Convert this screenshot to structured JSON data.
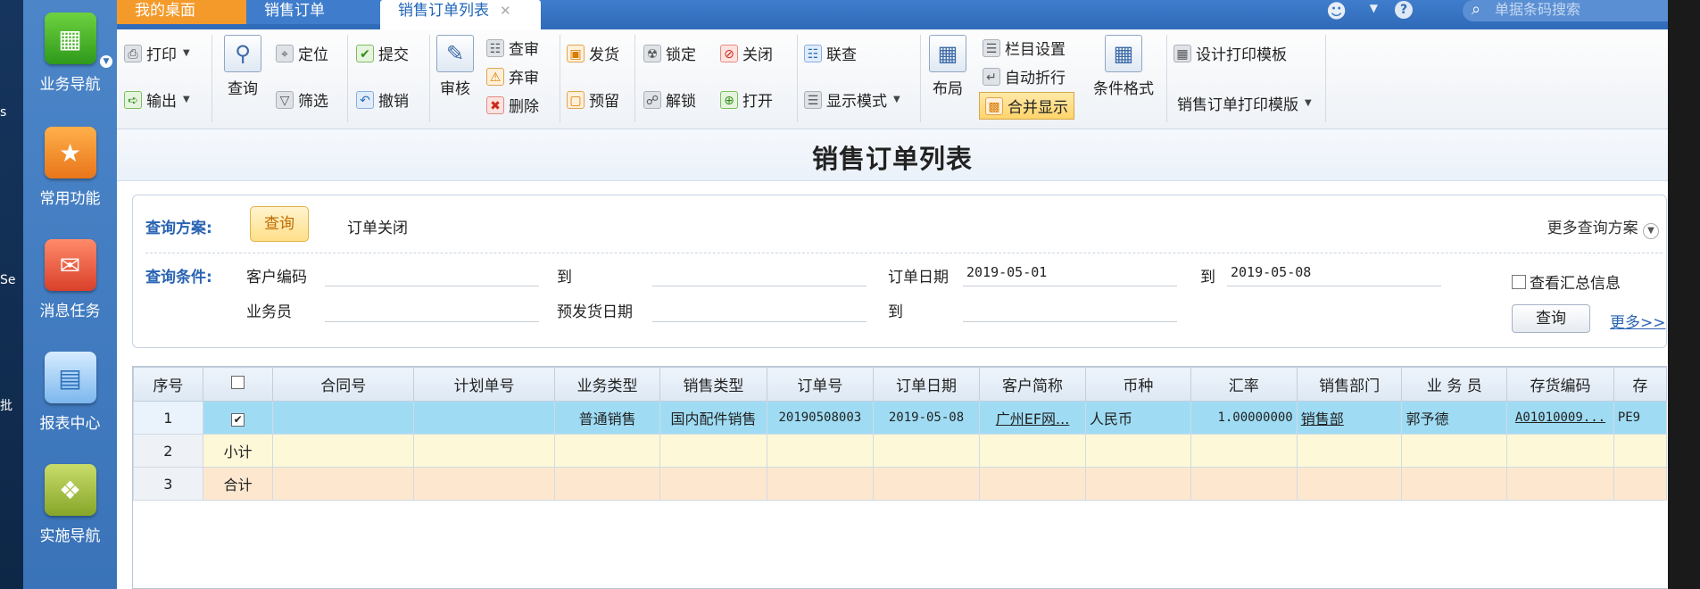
{
  "desktop": {
    "fragments": [
      "s",
      "Se",
      "批"
    ]
  },
  "nav": {
    "items": [
      {
        "label": "业务导航"
      },
      {
        "label": "常用功能"
      },
      {
        "label": "消息任务"
      },
      {
        "label": "报表中心"
      },
      {
        "label": "实施导航"
      }
    ]
  },
  "tabs": {
    "home": "我的桌面",
    "sales_order": "销售订单",
    "active": "销售订单列表"
  },
  "search": {
    "placeholder": "单据条码搜索"
  },
  "toolbar": {
    "print": "打印",
    "export": "输出",
    "query": "查询",
    "locate": "定位",
    "filter": "筛选",
    "submit": "提交",
    "revoke": "撤销",
    "audit": "审核",
    "check": "查审",
    "abandon": "弃审",
    "delete": "删除",
    "ship": "发货",
    "reserve": "预留",
    "lock": "锁定",
    "unlock": "解锁",
    "close": "关闭",
    "open": "打开",
    "link_query": "联查",
    "display_mode": "显示模式",
    "layout": "布局",
    "column_settings": "栏目设置",
    "auto_wrap": "自动折行",
    "merge_display": "合并显示",
    "conditional_format": "条件格式",
    "design_print_template": "设计打印模板",
    "print_template": "销售订单打印模版"
  },
  "page": {
    "title": "销售订单列表"
  },
  "query": {
    "scheme_label": "查询方案:",
    "scheme_active": "查询",
    "scheme_other": "订单关闭",
    "more_schemes": "更多查询方案",
    "conditions_label": "查询条件:",
    "customer_code": "客户编码",
    "to": "到",
    "order_date": "订单日期",
    "order_date_from": "2019-05-01",
    "order_date_to": "2019-05-08",
    "salesperson": "业务员",
    "pre_ship_date": "预发货日期",
    "view_summary": "查看汇总信息",
    "query_button": "查询",
    "more_link": "更多>>"
  },
  "grid": {
    "columns": [
      "序号",
      "",
      "合同号",
      "计划单号",
      "业务类型",
      "销售类型",
      "订单号",
      "订单日期",
      "客户简称",
      "币种",
      "汇率",
      "销售部门",
      "业 务 员",
      "存货编码",
      "存"
    ],
    "rows": [
      {
        "idx": "1",
        "check": "✔",
        "contract": "",
        "plan": "",
        "biz_type": "普通销售",
        "sales_type": "国内配件销售",
        "order_no": "20190508003",
        "order_date": "2019-05-08",
        "customer": "广州EF网...",
        "currency": "人民币",
        "rate": "1.00000000",
        "dept": "销售部",
        "salesperson": "郭予德",
        "inv_code": "A01010009...",
        "inv_name": "PE9"
      },
      {
        "idx": "2",
        "label": "小计"
      },
      {
        "idx": "3",
        "label": "合计"
      }
    ]
  }
}
